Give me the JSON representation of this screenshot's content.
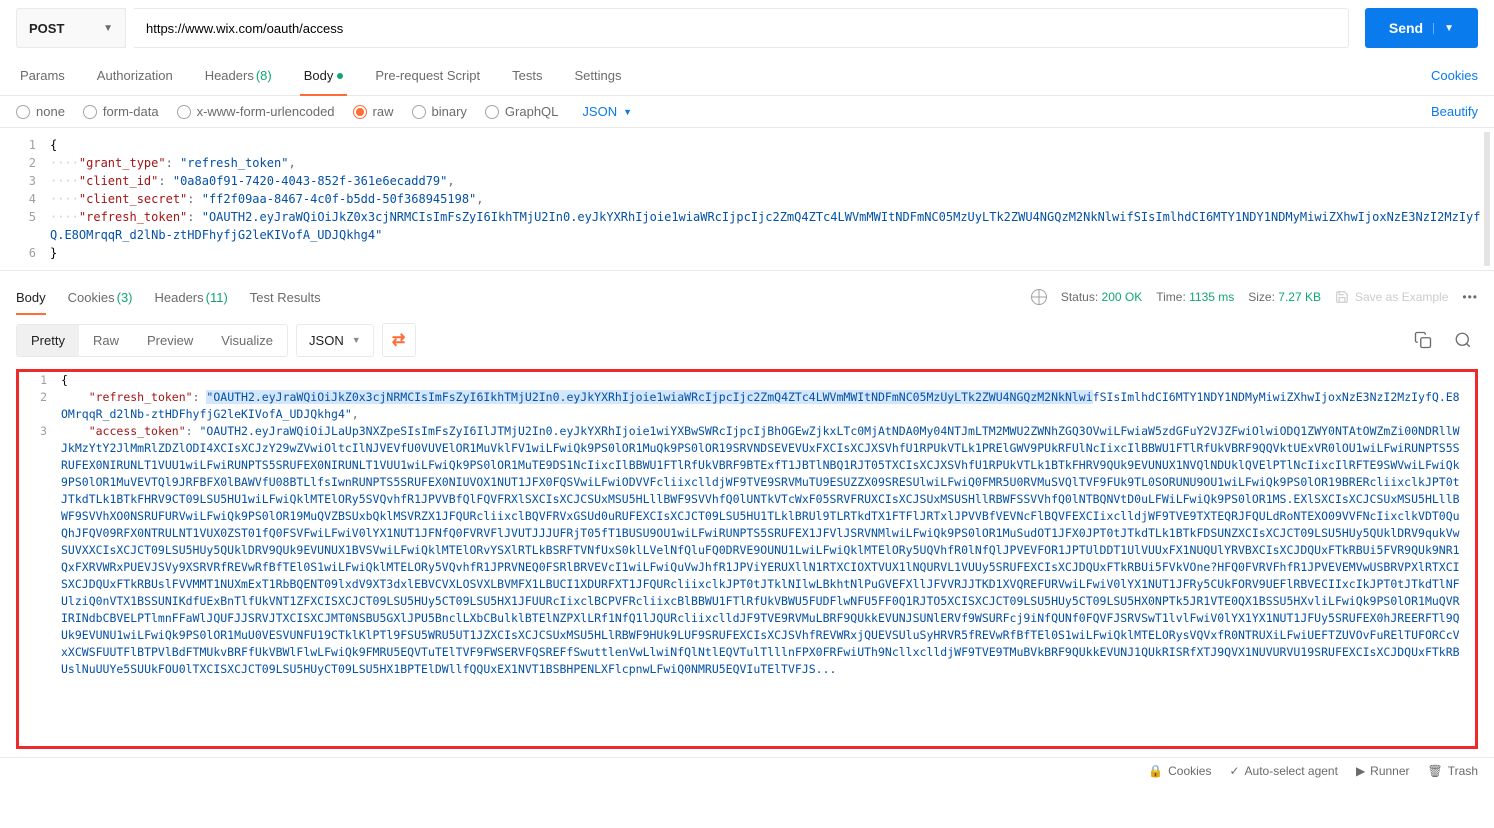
{
  "request": {
    "method": "POST",
    "url": "https://www.wix.com/oauth/access",
    "send_label": "Send",
    "tabs": {
      "params": "Params",
      "auth": "Authorization",
      "headers": "Headers",
      "headers_count": "(8)",
      "body": "Body",
      "prereq": "Pre-request Script",
      "tests": "Tests",
      "settings": "Settings"
    },
    "cookies_link": "Cookies",
    "body_types": {
      "none": "none",
      "form": "form-data",
      "url": "x-www-form-urlencoded",
      "raw": "raw",
      "binary": "binary",
      "graphql": "GraphQL"
    },
    "raw_type": "JSON",
    "beautify": "Beautify",
    "body_lines": [
      {
        "n": "1",
        "indent": "",
        "brace": "{"
      },
      {
        "n": "2",
        "indent": "····",
        "key": "\"grant_type\"",
        "sep": ": ",
        "val": "\"refresh_token\"",
        "tail": ","
      },
      {
        "n": "3",
        "indent": "····",
        "key": "\"client_id\"",
        "sep": ": ",
        "val": "\"0a8a0f91-7420-4043-852f-361e6ecadd79\"",
        "tail": ","
      },
      {
        "n": "4",
        "indent": "····",
        "key": "\"client_secret\"",
        "sep": ": ",
        "val": "\"ff2f09aa-8467-4c0f-b5dd-50f368945198\"",
        "tail": ","
      },
      {
        "n": "5",
        "indent": "····",
        "key": "\"refresh_token\"",
        "sep": ": ",
        "val": "\"OAUTH2.eyJraWQiOiJkZ0x3cjNRMCIsImFsZyI6IkhTMjU2In0.eyJkYXRhIjoie1wiaWRcIjpcIjc2ZmQ4ZTc4LWVmMWItNDFmNC05MzUyLTk2ZWU4NGQzM2NkNlwifSIsImlhdCI6MTY1NDY1NDMyMiwiZXhwIjoxNzE3NzI2MzIyfQ.E8OMrqqR_d2lNb-ztHDFhyfjG2leKIVofA_UDJQkhg4\""
      },
      {
        "n": "6",
        "indent": "",
        "brace": "}"
      }
    ]
  },
  "response": {
    "tabs": {
      "body": "Body",
      "cookies": "Cookies",
      "cookies_count": "(3)",
      "headers": "Headers",
      "headers_count": "(11)",
      "test": "Test Results"
    },
    "status_label": "Status:",
    "status_val": "200 OK",
    "time_label": "Time:",
    "time_val": "1135 ms",
    "size_label": "Size:",
    "size_val": "7.27 KB",
    "save_example": "Save as Example",
    "view": {
      "pretty": "Pretty",
      "raw": "Raw",
      "preview": "Preview",
      "visualize": "Visualize",
      "type": "JSON"
    },
    "body_lines": [
      {
        "n": "1",
        "content_brace": "{"
      },
      {
        "n": "2",
        "key": "\"refresh_token\"",
        "sep": ": ",
        "val_pre": "\"OAUTH2.eyJraWQiOiJkZ0x3cjNRMCIsImFsZyI6IkhTMjU2In0.eyJkYXRhIjoie1wiaWRcIjpcIjc2ZmQ4ZTc4LWVmMWItNDFmNC05MzUyLTk2ZWU4NGQzM2NkNlwi",
        "val_post": "fSIsImlhdCI6MTY1NDY1NDMyMiwiZXhwIjoxNzE3NzI2MzIyfQ.E8OMrqqR_d2lNb-ztHDFhyfjG2leKIVofA_UDJQkhg4\"",
        "tail": ","
      },
      {
        "n": "3",
        "key": "\"access_token\"",
        "sep": ": ",
        "val": "\"OAUTH2.eyJraWQiOiJLaUp3NXZpeSIsImFsZyI6IlJTMjU2In0.eyJkYXRhIjoie1wiYXBwSWRcIjpcIjBhOGEwZjkxLTc0MjAtNDA0My04NTJmLTM2MWU2ZWNhZGQ3OVwiLFwiaW5zdGFuY2VJZFwiOlwiODQ1ZWY0NTAtOWZmZi00NDRllWJkMzYtY2JlMmRlZDZlODI4XCIsXCJzY29wZVwiOltcIlNJVEVfU0VUVElOR1MuVklFV1wiLFwiQk9PS0lOR1MuQk9PS0lOR19SRVNDSEVEVUxFXCIsXCJXSVhfU1RPUkVTLk1PRElGWV9PUkRFUlNcIixcIlBBWU1FTlRfUkVBRF9QQVktUExVR0lOU1wiLFwiRUNPTS5SRUFEX0NIRUNLT1VUU1wiLFwiRUNPTS5SRUFEX0NIRUNLT1VUU1wiLFwiQk9PS0lOR1MuTE9DS1NcIixcIlBBWU1FTlRfUkVBRF9BTExfT1JBTlNBQ1RJT05TXCIsXCJXSVhfU1RPUkVTLk1BTkFHRV9QUk9EVUNUX1NVQlNDUklQVElPTlNcIixcIlRFTE9SWVwiLFwiQk9PS0lOR1MuVEVTQl9JRFBFX0lBAWVfU08BTLlfsIwnRUNPTS5SRUFEX0NIUVOX1NUT1JFX0FQSVwiLFwiODVVFcliixclldjWF9TVE9SRVMuTU9ESUZZX09SRESUlwiLFwiQ0FMR5U0RVMuSVQlTVF9FUk9TL0SORUNU9OU1wiLFwiQk9PS0lOR19BRERcliixclkJPT0tJTkdTLk1BTkFHRV9CT09LSU5HU1wiLFwiQklMTElORy5SVQvhfR1JPVVBfQlFQVFRXlSXCIsXCJCSUxMSU5HLllBWF9SVVhfQ0lUNTkVTcWxF05SRVFRUXCIsXCJSUxMSUSHllRBWFSSVVhfQ0lNTBQNVtD0uLFWiLFwiQk9PS0lOR1MS.EXlSXCIsXCJCSUxMSU5HLllBWF9SVVhXO0NSRUFURVwiLFwiQk9PS0lOR19MuQVZBSUxbQklMSVRZX1JFQURcliixclBQVFRVxGSUd0uRUFEXCIsXCJCT09LSU5HU1TLklBRUl9TLRTkdTX1FTFlJRTxlJPVVBfVEVNcFlBQVFEXCIixclldjWF9TVE9TXTEQRJFQULdRoNTEXO09VVFNcIixclkVDT0QuQhJFQV09RFX0NTRULNT1VUX0ZST01fQ0FSVFwiLFwiV0lYX1NUT1JFNfQ0FVRVFlJVUTJJJUFRjT05fT1BUSU9OU1wiLFwiRUNPTS5SRUFEX1JFVlJSRVNMlwiLFwiQk9PS0lOR1MuSudOT1JFX0JPT0tJTkdTLk1BTkFDSUNZXCIsXCJCT09LSU5HUy5QUklDRV9qukVwSUVXXCIsXCJCT09LSU5HUy5QUklDRV9QUk9EVUNUX1BVSVwiLFwiQklMTElORvYSXlRTLkBSRFTVNfUxS0klLVelNfQluFQ0DRVE9OUNU1LwiLFwiQklMTElORy5UQVhfR0lNfQlJPVEVFOR1JPTUlDDT1UlVUUxFX1NUQUlYRVBXCIsXCJDQUxFTkRBUi5FVR9QUk9NR1QxFXRVWRxPUEVJSVy9XSRVRfREVwRfBfTEl0S1wiLFwiQklMTELORy5VQvhfR1JPRVNEQ0FSRlBRVEVcI1wiLFwiQuVwJhfR1JPViYERUXllN1RTXCIOXTVUX1lNQURVL1VUUy5SRUFEXCIsXCJDQUxFTkRBUi5FVkVOne?HFQ0FVRVFhfR1JPVEVEMVwUSBRVPXlRTXCISXCJDQUxFTkRBUslFVVMMT1NUXmExT1RbBQENT09lxdV9XT3dxlEBVCVXLOSVXLBVMFX1LBUCI1XDURFXT1JFQURcliixclkJPT0tJTklNIlwLBkhtNlPuGVEFXllJFVVRJJTKD1XVQREFURVwiLFwiV0lYX1NUT1JFRy5CUkFORV9UEFlRBVECIIxcIkJPT0tJTkdTlNFUlziQ0nVTX1BSSUNIKdfUExBnTlfUkVNT1ZFXCISXCJCT09LSU5HUy5CT09LSU5HX1JFUURcIixclBCPVFRcliixcBlBBWU1FTlRfUkVBWU5FUDFlwNFU5FF0Q1RJTO5XCISXCJCT09LSU5HUy5CT09LSU5HX0NPTk5JR1VTE0QX1BSSU5HXvliLFwiQk9PS0lOR1MuQVRIRINdbCBVELPTlmnFFaWlJQUFJJSRVJTXCISXCJMT0NSBU5GXlJPU5BnclLXbCBulklBTElNZPXlLRf1NfQ1lJQURcliixclldJF9TVE9RVMuLBRF9QUkkEVUNJSUNlERVf9WSURFcj9iNfQUNf0FQVFJSRVSwT1lvlFwiV0lYX1YX1NUT1JFUy5SRUFEX0hJREERFTl9QUk9EVUNU1wiLFwiQk9PS0lOR1MuU0VESVUNFU19CTklKlPTl9FSU5WRU5UT1JZXCIsXCJCSUxMSU5HLlRBWF9HUk9LUF9SRUFEXCIsXCJSVhfREVWRxjQUEVSUluSyHRVR5fREVwRfBfTEl0S1wiLFwiQklMTELORysVQVxfR0NTRUXiLFwiUEFTZUVOvFuRElTUFORCcVxXCWSFUUTFlBTPVlBdFTMUkvBRFfUkVBWlFlwLFwiQk9FMRU5EQVTuTElTVF9FWSERVFQSREFfSwuttlenVwLlwiNfQlNtlEQVTulTlllnFPX0FRFwiUTh9NcllxclldjWF9TVE9TMuBVkBRF9QUkkEVUNJ1QUkRISRfXTJ9QVX1NUVURVU19SRUFEXCIsXCJDQUxFTkRBUslNuUUYe5SUUkFOU0lTXCISXCJCT09LSU5HUyCT09LSU5HX1BPTElDWllfQQUxEX1NVT1BSBHPENLXFlcpnwLFwiQ0NMRU5EQVIuTElTVFJS..."
      }
    ]
  },
  "footer": {
    "cookies": "Cookies",
    "auto": "Auto-select agent",
    "runner": "Runner",
    "trash": "Trash"
  }
}
